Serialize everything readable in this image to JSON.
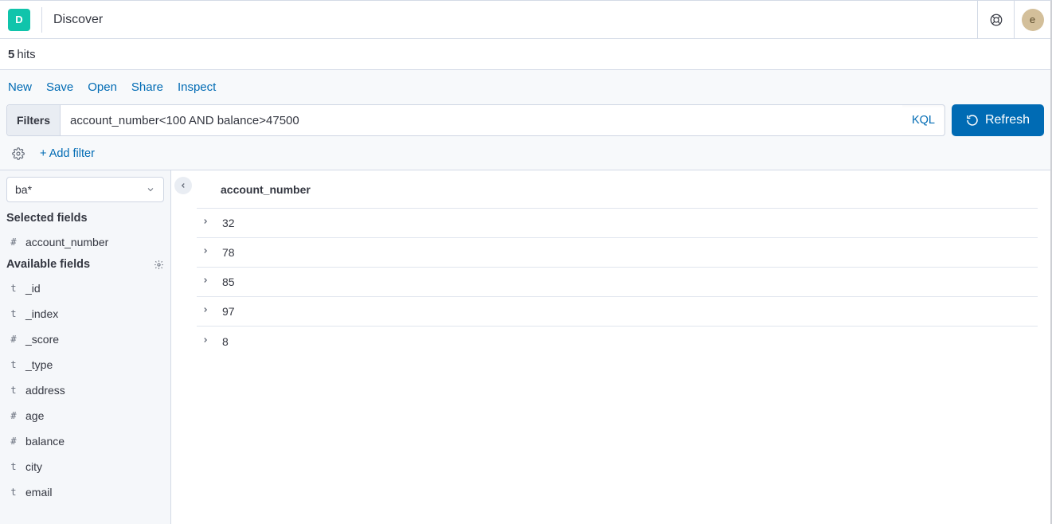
{
  "header": {
    "logo_letter": "D",
    "title": "Discover",
    "avatar_letter": "e"
  },
  "hits": {
    "count": "5",
    "label": "hits"
  },
  "menu": {
    "new": "New",
    "save": "Save",
    "open": "Open",
    "share": "Share",
    "inspect": "Inspect"
  },
  "query": {
    "filters_label": "Filters",
    "value": "account_number<100 AND balance>47500",
    "kql_label": "KQL",
    "refresh_label": "Refresh"
  },
  "filterbar": {
    "add_filter": "+ Add filter"
  },
  "sidebar": {
    "index_pattern": "ba*",
    "selected_fields_header": "Selected fields",
    "available_fields_header": "Available fields",
    "selected": [
      {
        "type": "#",
        "name": "account_number"
      }
    ],
    "available": [
      {
        "type": "t",
        "name": "_id"
      },
      {
        "type": "t",
        "name": "_index"
      },
      {
        "type": "#",
        "name": "_score"
      },
      {
        "type": "t",
        "name": "_type"
      },
      {
        "type": "t",
        "name": "address"
      },
      {
        "type": "#",
        "name": "age"
      },
      {
        "type": "#",
        "name": "balance"
      },
      {
        "type": "t",
        "name": "city"
      },
      {
        "type": "t",
        "name": "email"
      }
    ]
  },
  "results": {
    "column_header": "account_number",
    "rows": [
      "32",
      "78",
      "85",
      "97",
      "8"
    ]
  }
}
